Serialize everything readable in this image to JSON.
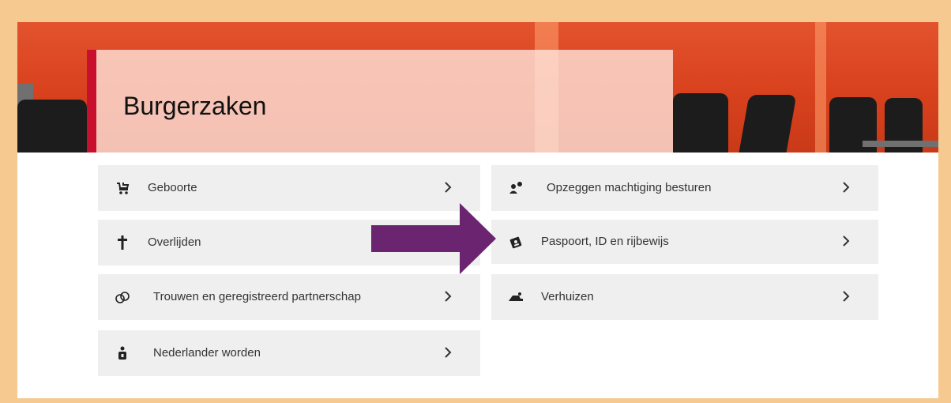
{
  "page": {
    "title": "Burgerzaken"
  },
  "tiles_left": [
    {
      "label": "Geboorte",
      "icon": "baby-carriage-icon"
    },
    {
      "label": "Overlijden",
      "icon": "cross-icon"
    },
    {
      "label": "Trouwen en geregistreerd partnerschap",
      "icon": "rings-icon"
    },
    {
      "label": "Nederlander worden",
      "icon": "person-lock-icon"
    }
  ],
  "tiles_right": [
    {
      "label": "Opzeggen machtiging besturen",
      "icon": "person-badge-icon"
    },
    {
      "label": "Paspoort, ID en rijbewijs",
      "icon": "id-card-icon"
    },
    {
      "label": "Verhuizen",
      "icon": "moving-icon"
    }
  ],
  "colors": {
    "accent_red": "#c8102e",
    "annotation_arrow": "#6b2570",
    "tile_bg": "#efefef",
    "frame": "#f5c98f"
  }
}
